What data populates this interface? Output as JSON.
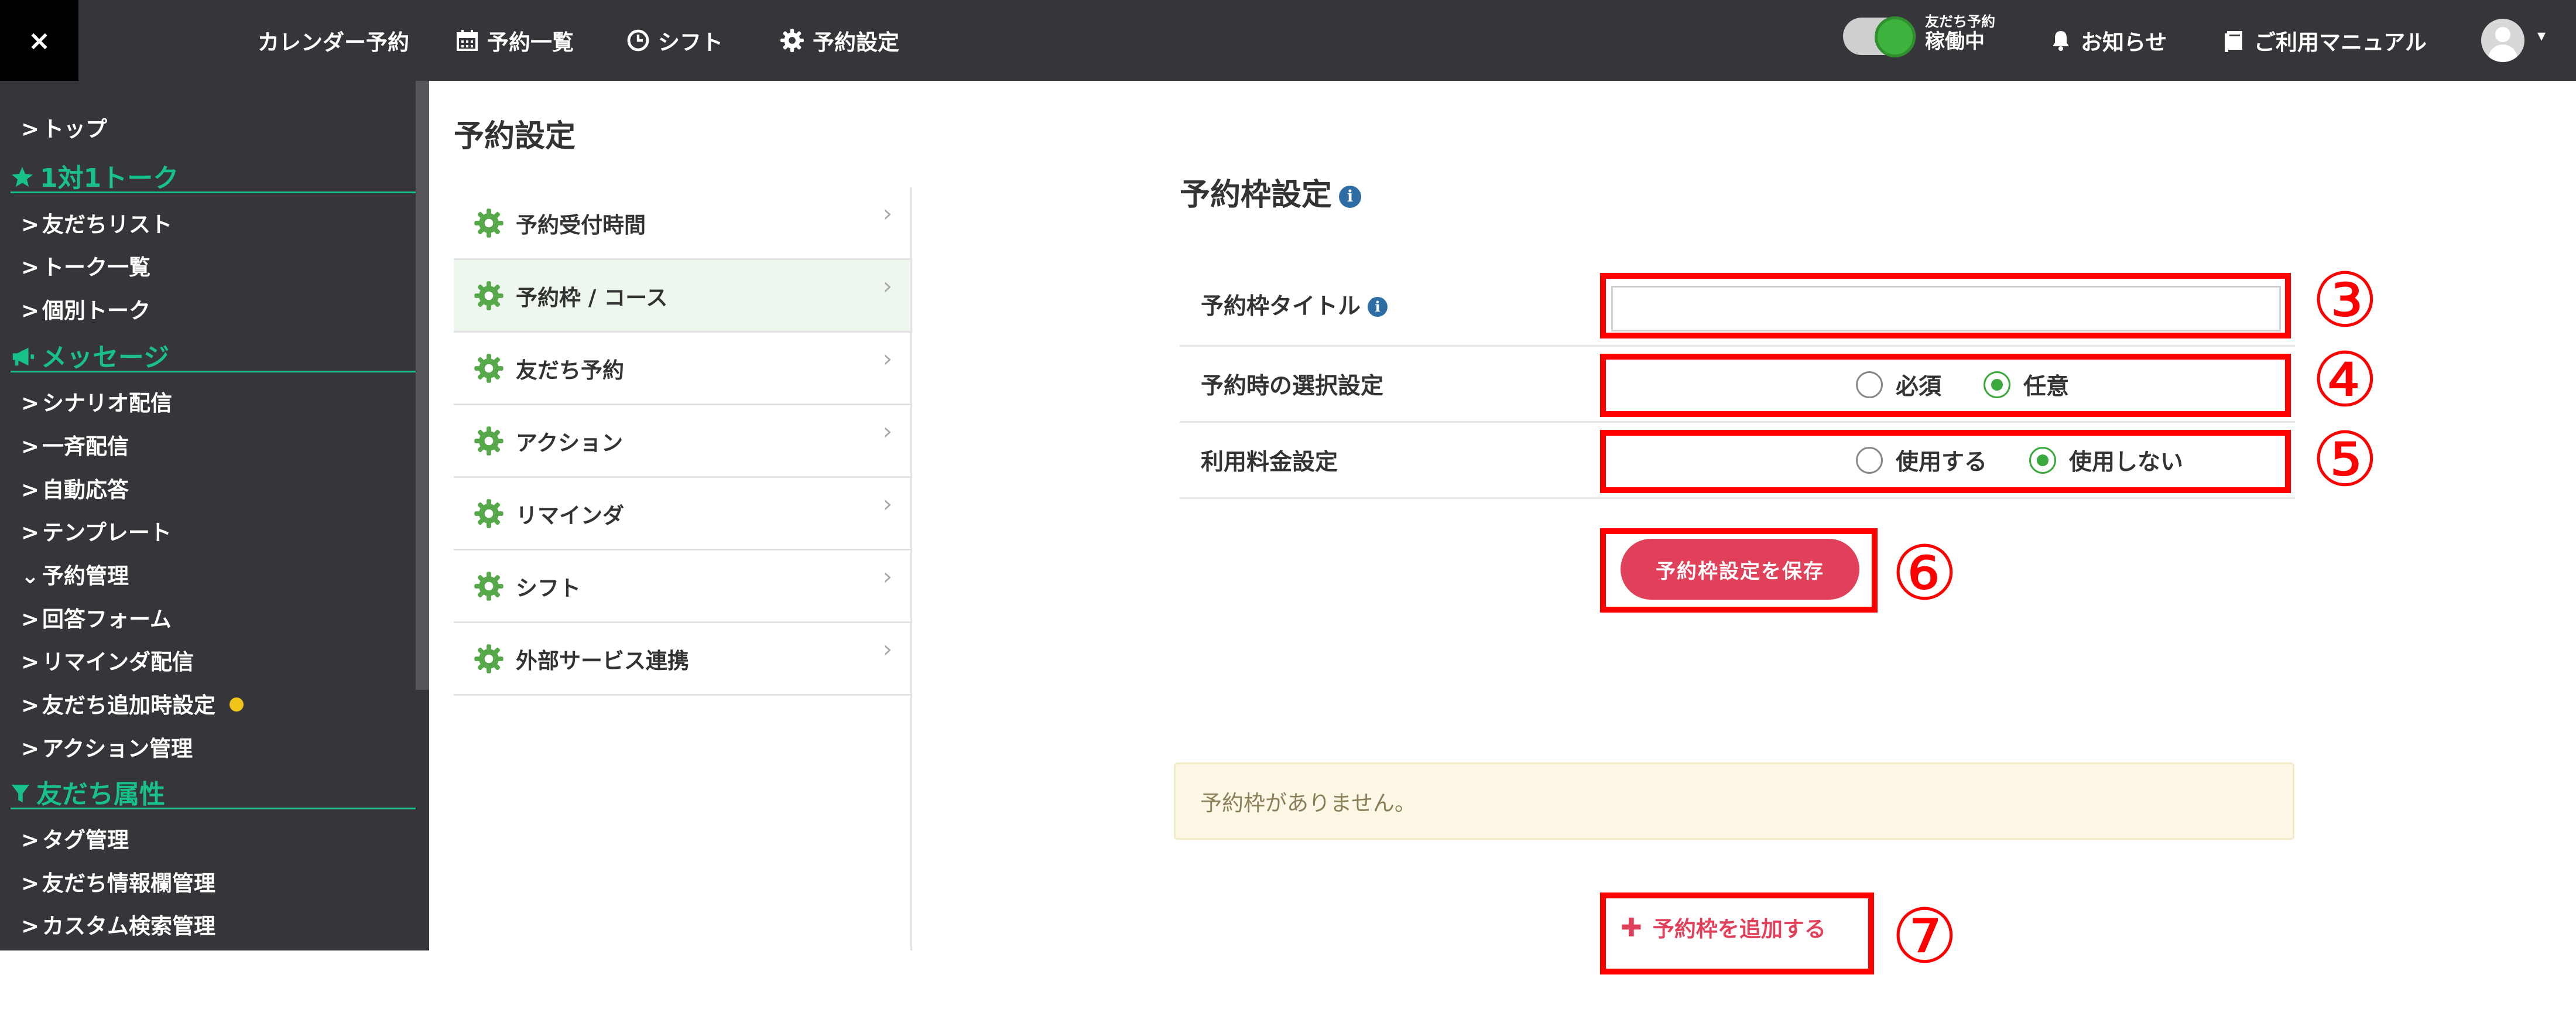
{
  "topbar": {
    "close_label": "×",
    "nav": [
      {
        "label": "カレンダー予約",
        "icon": ""
      },
      {
        "label": "予約一覧",
        "icon": "calendar-icon"
      },
      {
        "label": "シフト",
        "icon": "clock-icon"
      },
      {
        "label": "予約設定",
        "icon": "gear-icon"
      }
    ],
    "toggle_small": "友だち予約",
    "toggle_status": "稼働中",
    "notice_label": "お知らせ",
    "manual_label": "ご利用マニュアル",
    "avatar_caret": "▾"
  },
  "sidebar": {
    "top": "トップ",
    "section_talk": "1対1トーク",
    "talk_items": [
      "友だちリスト",
      "トーク一覧",
      "個別トーク"
    ],
    "section_message": "メッセージ",
    "message_items": [
      "シナリオ配信",
      "一斉配信",
      "自動応答",
      "テンプレート"
    ],
    "reservation": "予約管理",
    "reservation_sub": [
      "回答フォーム",
      "リマインダ配信",
      "友だち追加時設定",
      "アクション管理"
    ],
    "section_attr": "友だち属性",
    "attr_items": [
      "タグ管理",
      "友だち情報欄管理",
      "カスタム検索管理"
    ]
  },
  "page": {
    "title": "予約設定"
  },
  "submenu": [
    {
      "label": "予約受付時間"
    },
    {
      "label": "予約枠 / コース"
    },
    {
      "label": "友だち予約"
    },
    {
      "label": "アクション"
    },
    {
      "label": "リマインダ"
    },
    {
      "label": "シフト"
    },
    {
      "label": "外部サービス連携"
    }
  ],
  "form": {
    "title": "予約枠設定",
    "rows": {
      "title_label": "予約枠タイトル",
      "title_value": "",
      "selection_label": "予約時の選択設定",
      "selection_options": [
        "必須",
        "任意"
      ],
      "selection_selected": "任意",
      "fee_label": "利用料金設定",
      "fee_options": [
        "使用する",
        "使用しない"
      ],
      "fee_selected": "使用しない"
    },
    "save_button": "予約枠設定を保存",
    "empty_message": "予約枠がありません。",
    "add_button": "予約枠を追加する"
  },
  "annotations": [
    "③",
    "④",
    "⑤",
    "⑥",
    "⑦"
  ],
  "colors": {
    "topbar_bg": "#363539",
    "accent_green": "#19c18a",
    "primary_red": "#e0405a",
    "annotation_red": "#ff0000"
  }
}
